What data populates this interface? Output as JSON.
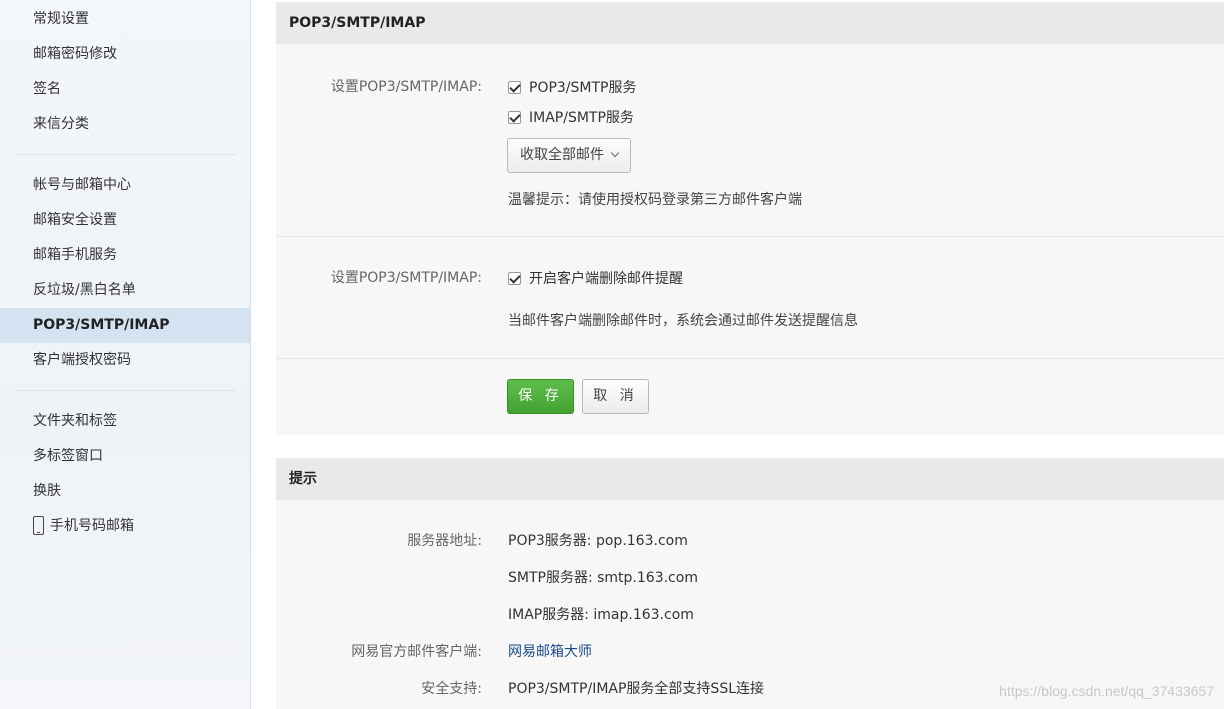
{
  "sidebar": {
    "groups": [
      [
        "常规设置",
        "邮箱密码修改",
        "签名",
        "来信分类"
      ],
      [
        "帐号与邮箱中心",
        "邮箱安全设置",
        "邮箱手机服务",
        "反垃圾/黑白名单",
        "POP3/SMTP/IMAP",
        "客户端授权密码"
      ],
      [
        "文件夹和标签",
        "多标签窗口",
        "换肤",
        "手机号码邮箱"
      ]
    ],
    "active": "POP3/SMTP/IMAP"
  },
  "settings_panel": {
    "title": "POP3/SMTP/IMAP",
    "row1_label": "设置POP3/SMTP/IMAP:",
    "option_pop3": "POP3/SMTP服务",
    "option_imap": "IMAP/SMTP服务",
    "fetch_select": "收取全部邮件",
    "tip": "温馨提示：请使用授权码登录第三方邮件客户端",
    "row2_label": "设置POP3/SMTP/IMAP:",
    "option_delete_alert": "开启客户端删除邮件提醒",
    "delete_alert_desc": "当邮件客户端删除邮件时，系统会通过邮件发送提醒信息",
    "save_label": "保 存",
    "cancel_label": "取 消"
  },
  "hint_panel": {
    "title": "提示",
    "server_label": "服务器地址:",
    "pop3_server": "POP3服务器: pop.163.com",
    "smtp_server": "SMTP服务器: smtp.163.com",
    "imap_server": "IMAP服务器: imap.163.com",
    "client_label": "网易官方邮件客户端:",
    "client_link": "网易邮箱大师",
    "security_label": "安全支持:",
    "security_value": "POP3/SMTP/IMAP服务全部支持SSL连接"
  },
  "watermark": "https://blog.csdn.net/qq_37433657",
  "colors": {
    "accent_green": "#4cae3a",
    "active_bg": "#d4e3f1",
    "link": "#1a4a8a"
  }
}
